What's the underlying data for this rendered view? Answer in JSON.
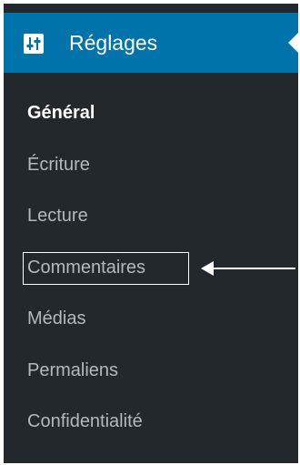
{
  "menu": {
    "title": "Réglages",
    "icon": "settings-sliders-icon",
    "items": [
      {
        "label": "Général",
        "current": true
      },
      {
        "label": "Écriture",
        "current": false
      },
      {
        "label": "Lecture",
        "current": false
      },
      {
        "label": "Commentaires",
        "current": false
      },
      {
        "label": "Médias",
        "current": false
      },
      {
        "label": "Permaliens",
        "current": false
      },
      {
        "label": "Confidentialité",
        "current": false
      }
    ]
  },
  "annotation": {
    "highlighted_item": "Commentaires",
    "arrow_icon": "arrow-left-icon"
  },
  "colors": {
    "sidebar_bg": "#23282d",
    "active_header": "#0073aa",
    "text_muted": "#b4b9be",
    "text_current": "#ffffff"
  }
}
